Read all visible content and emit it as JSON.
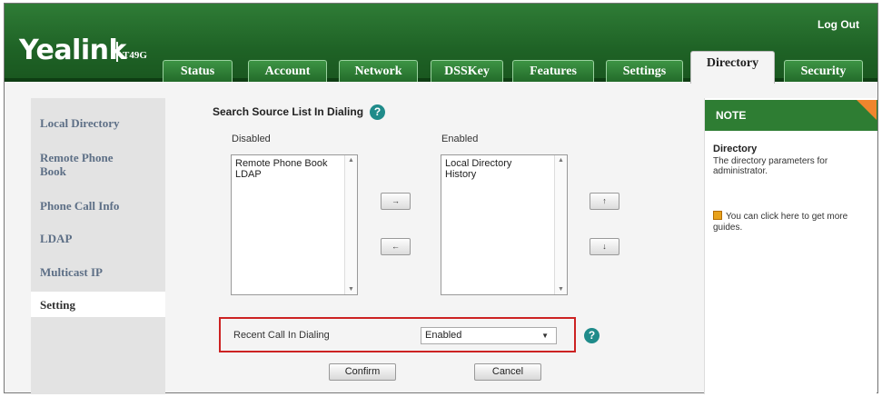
{
  "header": {
    "logo": "Yealink",
    "model": "T49G",
    "logout": "Log Out"
  },
  "tabs": [
    {
      "label": "Status"
    },
    {
      "label": "Account"
    },
    {
      "label": "Network"
    },
    {
      "label": "DSSKey"
    },
    {
      "label": "Features"
    },
    {
      "label": "Settings"
    },
    {
      "label": "Directory",
      "active": true
    },
    {
      "label": "Security"
    }
  ],
  "sidebar": {
    "items": [
      {
        "label": "Local Directory"
      },
      {
        "label": "Remote Phone Book"
      },
      {
        "label": "Phone Call Info"
      },
      {
        "label": "LDAP"
      },
      {
        "label": "Multicast IP"
      },
      {
        "label": "Setting",
        "active": true
      }
    ]
  },
  "main": {
    "title": "Search Source List In Dialing",
    "disabled_label": "Disabled",
    "enabled_label": "Enabled",
    "disabled_items": [
      "Remote Phone Book",
      "LDAP"
    ],
    "enabled_items": [
      "Local Directory",
      "History"
    ],
    "move_right": "→",
    "move_left": "←",
    "move_up": "↑",
    "move_down": "↓",
    "recent_call_label": "Recent Call In Dialing",
    "recent_call_value": "Enabled",
    "confirm": "Confirm",
    "cancel": "Cancel"
  },
  "note": {
    "header": "NOTE",
    "heading": "Directory",
    "text": "The directory parameters for administrator.",
    "guide": "You can click here to get more guides."
  },
  "colors": {
    "header_green": "#1f6326",
    "tab_green": "#2f7c36",
    "nav_text": "#5d6f86",
    "note_accent": "#f0852d",
    "help_icon": "#1f8b8a",
    "highlight_border": "#cc2222"
  }
}
